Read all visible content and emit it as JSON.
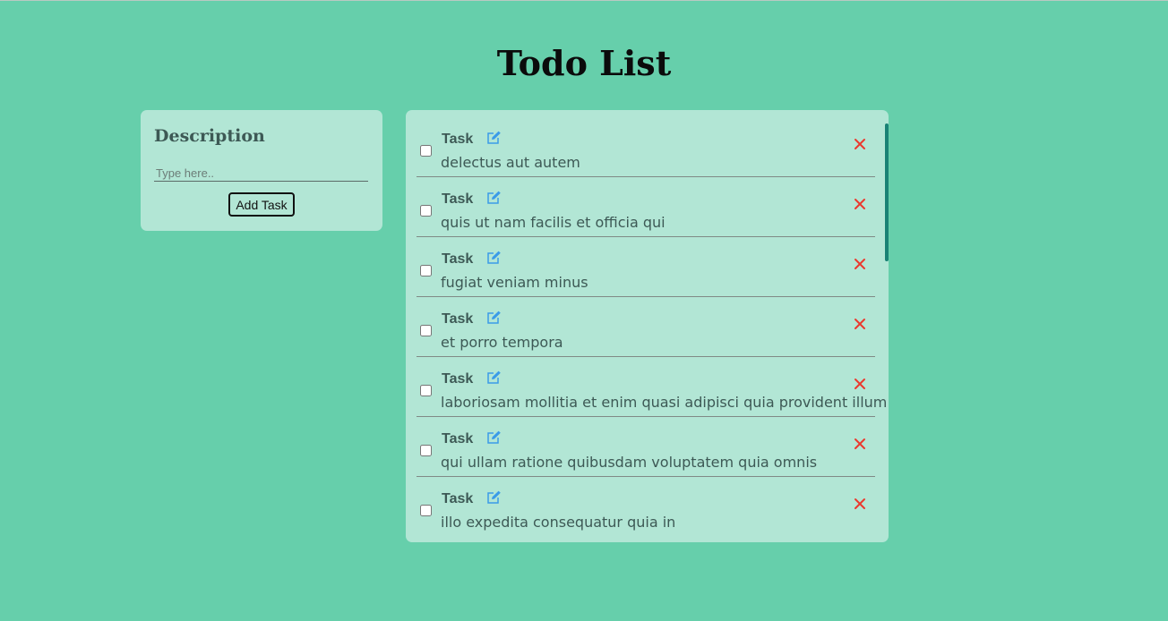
{
  "page": {
    "title": "Todo List"
  },
  "form": {
    "title": "Description",
    "input_placeholder": "Type here..",
    "input_value": "",
    "add_button_label": "Add Task"
  },
  "tasks": [
    {
      "label": "Task",
      "description": "delectus aut autem",
      "completed": false
    },
    {
      "label": "Task",
      "description": "quis ut nam facilis et officia qui",
      "completed": false
    },
    {
      "label": "Task",
      "description": "fugiat veniam minus",
      "completed": false
    },
    {
      "label": "Task",
      "description": "et porro tempora",
      "completed": false
    },
    {
      "label": "Task",
      "description": "laboriosam mollitia et enim quasi adipisci quia provident illum",
      "completed": false
    },
    {
      "label": "Task",
      "description": "qui ullam ratione quibusdam voluptatem quia omnis",
      "completed": false
    },
    {
      "label": "Task",
      "description": "illo expedita consequatur quia in",
      "completed": false
    }
  ],
  "icons": {
    "edit": "edit-icon",
    "delete": "close-icon"
  },
  "colors": {
    "background": "#66cfab",
    "card": "#b2e6d5",
    "text": "#3d5955",
    "edit_icon": "#3b9be8",
    "delete_icon": "#ea3a2e",
    "scrollbar": "#198275"
  }
}
